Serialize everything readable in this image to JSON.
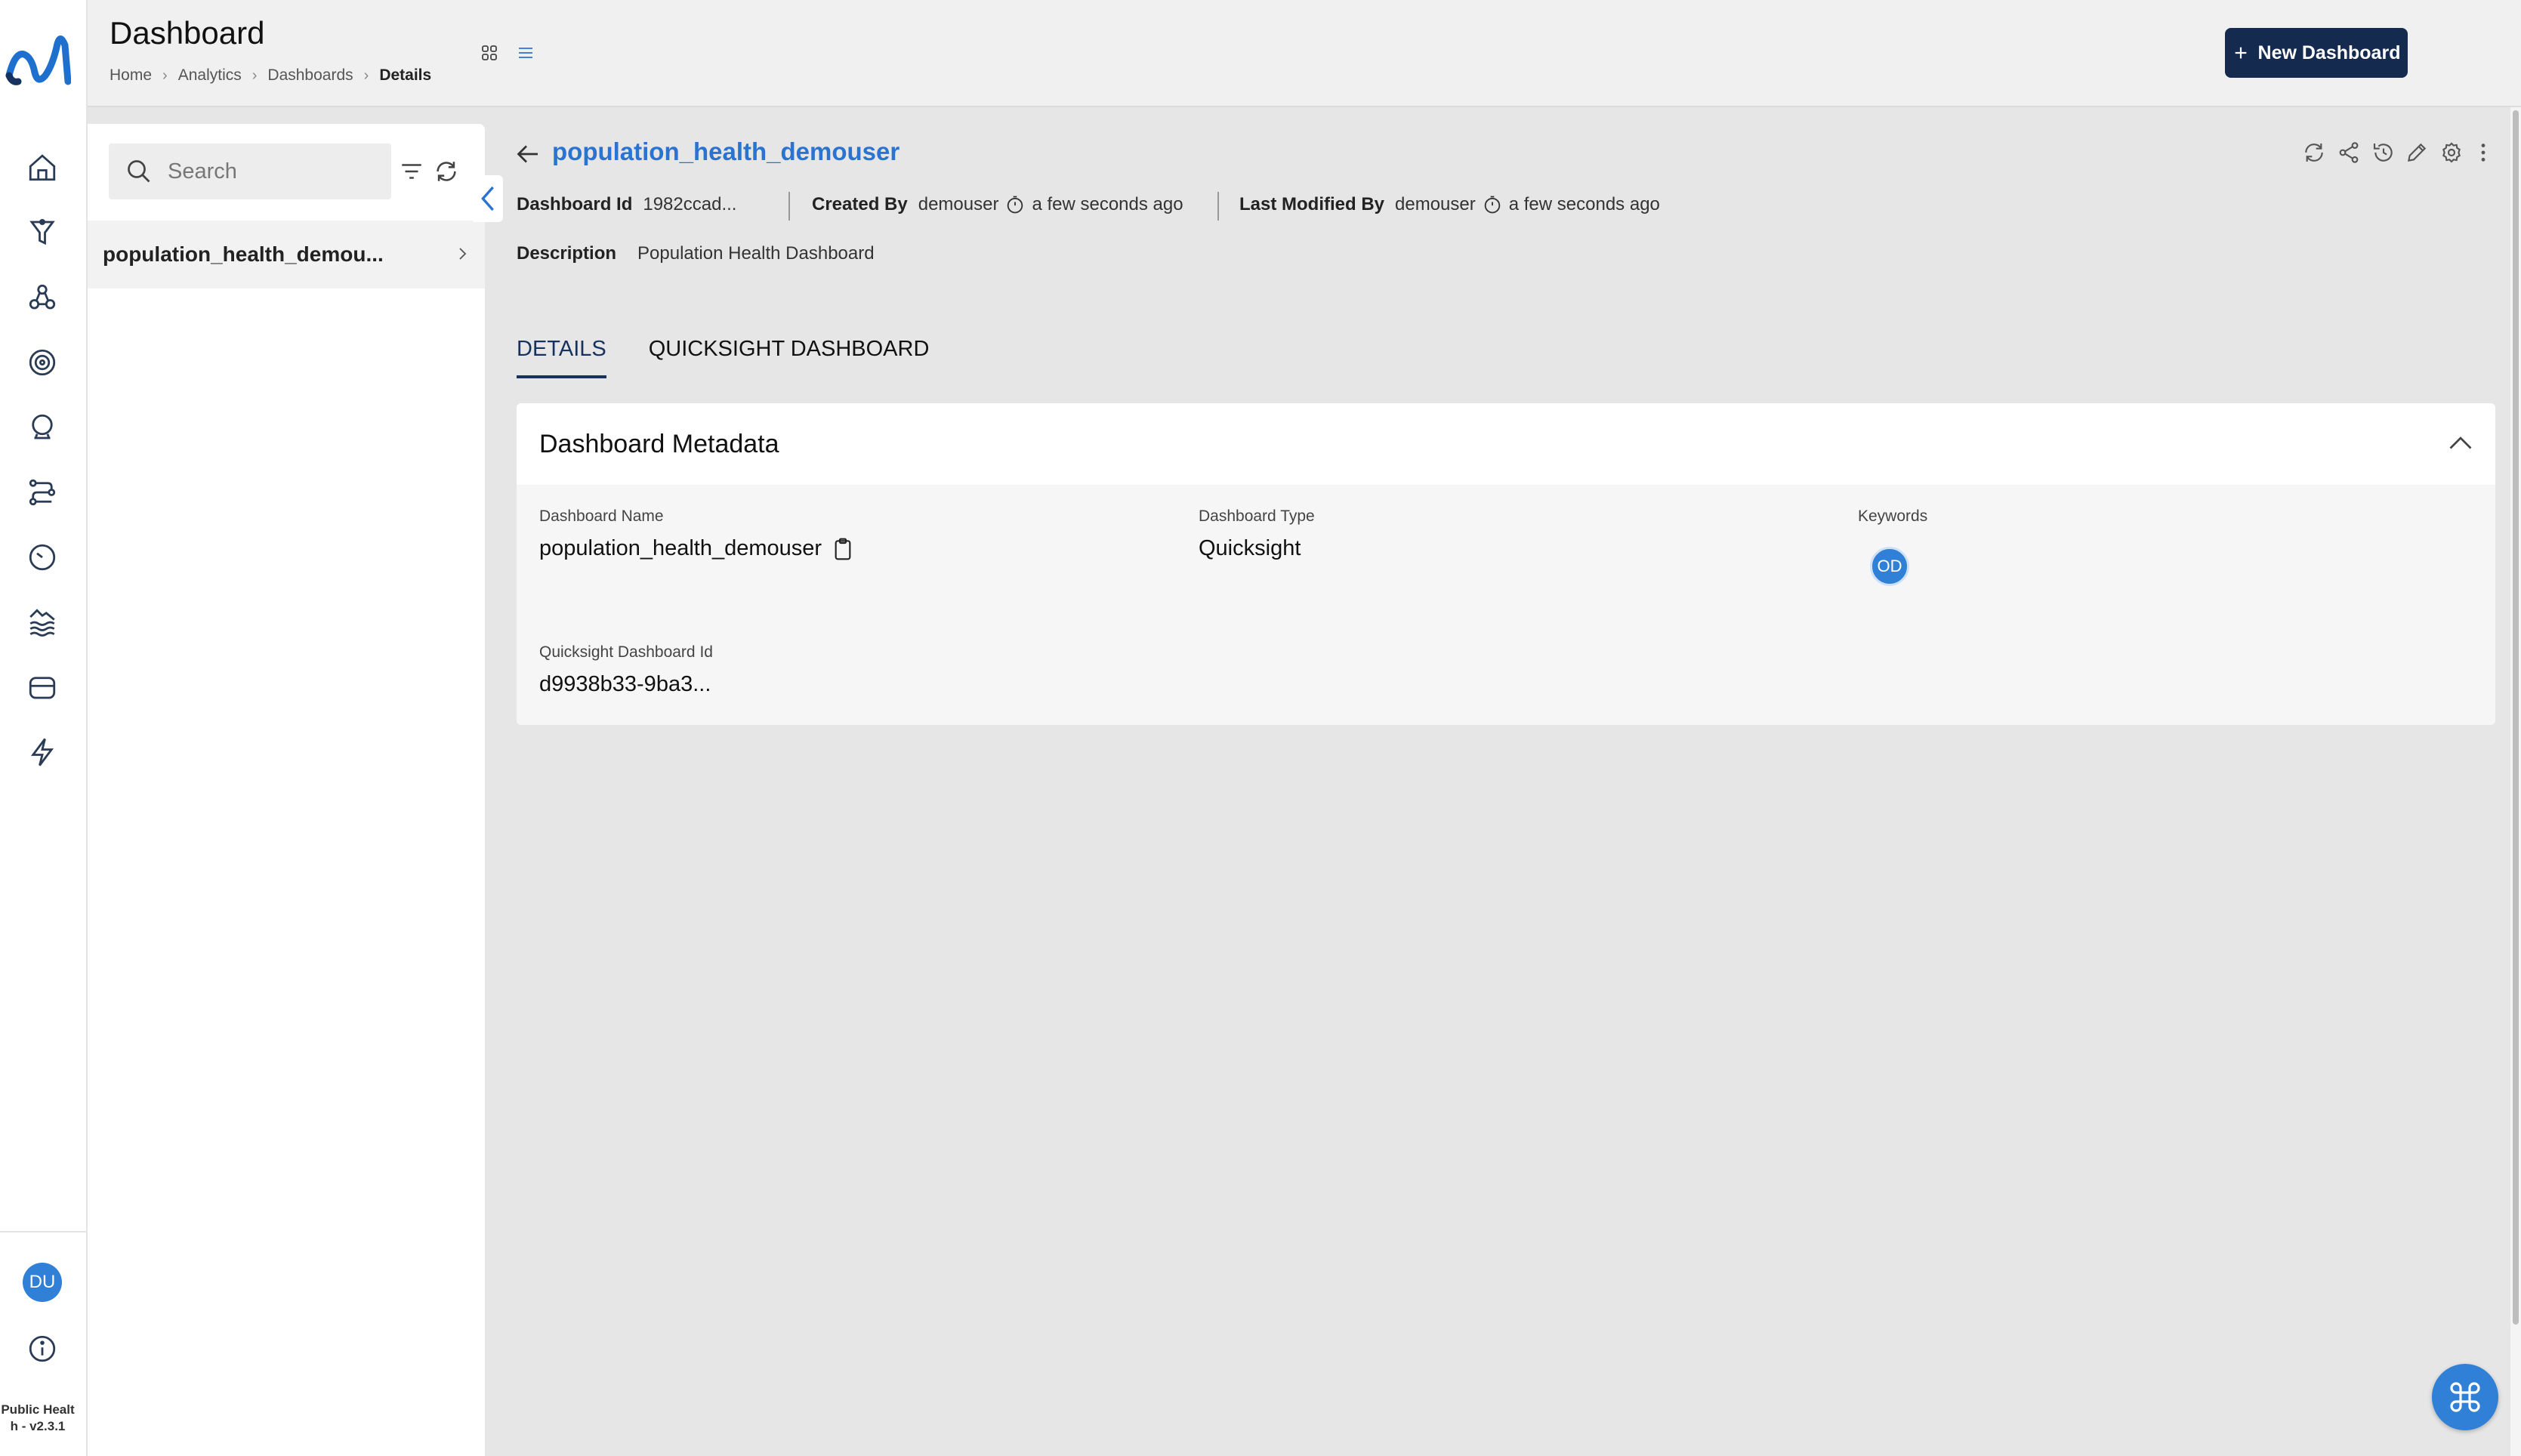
{
  "app": {
    "version_label": "Public Health - v2.3.1"
  },
  "user": {
    "initials": "DU"
  },
  "header": {
    "title": "Dashboard",
    "breadcrumbs": [
      "Home",
      "Analytics",
      "Dashboards",
      "Details"
    ],
    "new_button_label": "New Dashboard",
    "new_button_icon": "plus-icon"
  },
  "sidebar_nav": [
    {
      "icon": "home-icon"
    },
    {
      "icon": "funnel-icon"
    },
    {
      "icon": "molecule-icon"
    },
    {
      "icon": "target-icon"
    },
    {
      "icon": "crystal-ball-icon"
    },
    {
      "icon": "pipeline-icon"
    },
    {
      "icon": "clock-icon"
    },
    {
      "icon": "lake-icon"
    },
    {
      "icon": "storage-icon"
    },
    {
      "icon": "lightning-icon"
    }
  ],
  "list_panel": {
    "search_placeholder": "Search",
    "items": [
      {
        "label": "population_health_demou..."
      }
    ]
  },
  "detail": {
    "name": "population_health_demouser",
    "dashboard_id_label": "Dashboard Id",
    "dashboard_id_value": "1982ccad...",
    "created_by_label": "Created By",
    "created_by_value": "demouser",
    "created_time": "a few seconds ago",
    "modified_by_label": "Last Modified By",
    "modified_by_value": "demouser",
    "modified_time": "a few seconds ago",
    "description_label": "Description",
    "description_value": "Population Health Dashboard",
    "actions": [
      "refresh-icon",
      "share-icon",
      "history-icon",
      "edit-icon",
      "settings-icon",
      "more-icon"
    ]
  },
  "tabs": [
    {
      "label": "DETAILS",
      "active": true
    },
    {
      "label": "QUICKSIGHT DASHBOARD",
      "active": false
    }
  ],
  "metadata_card": {
    "title": "Dashboard Metadata",
    "fields": {
      "name_label": "Dashboard Name",
      "name_value": "population_health_demouser",
      "type_label": "Dashboard Type",
      "type_value": "Quicksight",
      "keywords_label": "Keywords",
      "keyword_chip": "OD",
      "qs_id_label": "Quicksight Dashboard Id",
      "qs_id_value": "d9938b33-9ba3..."
    }
  },
  "colors": {
    "accent_blue": "#2a73d1",
    "primary_dark": "#142a4f",
    "avatar_blue": "#2f80d6"
  }
}
